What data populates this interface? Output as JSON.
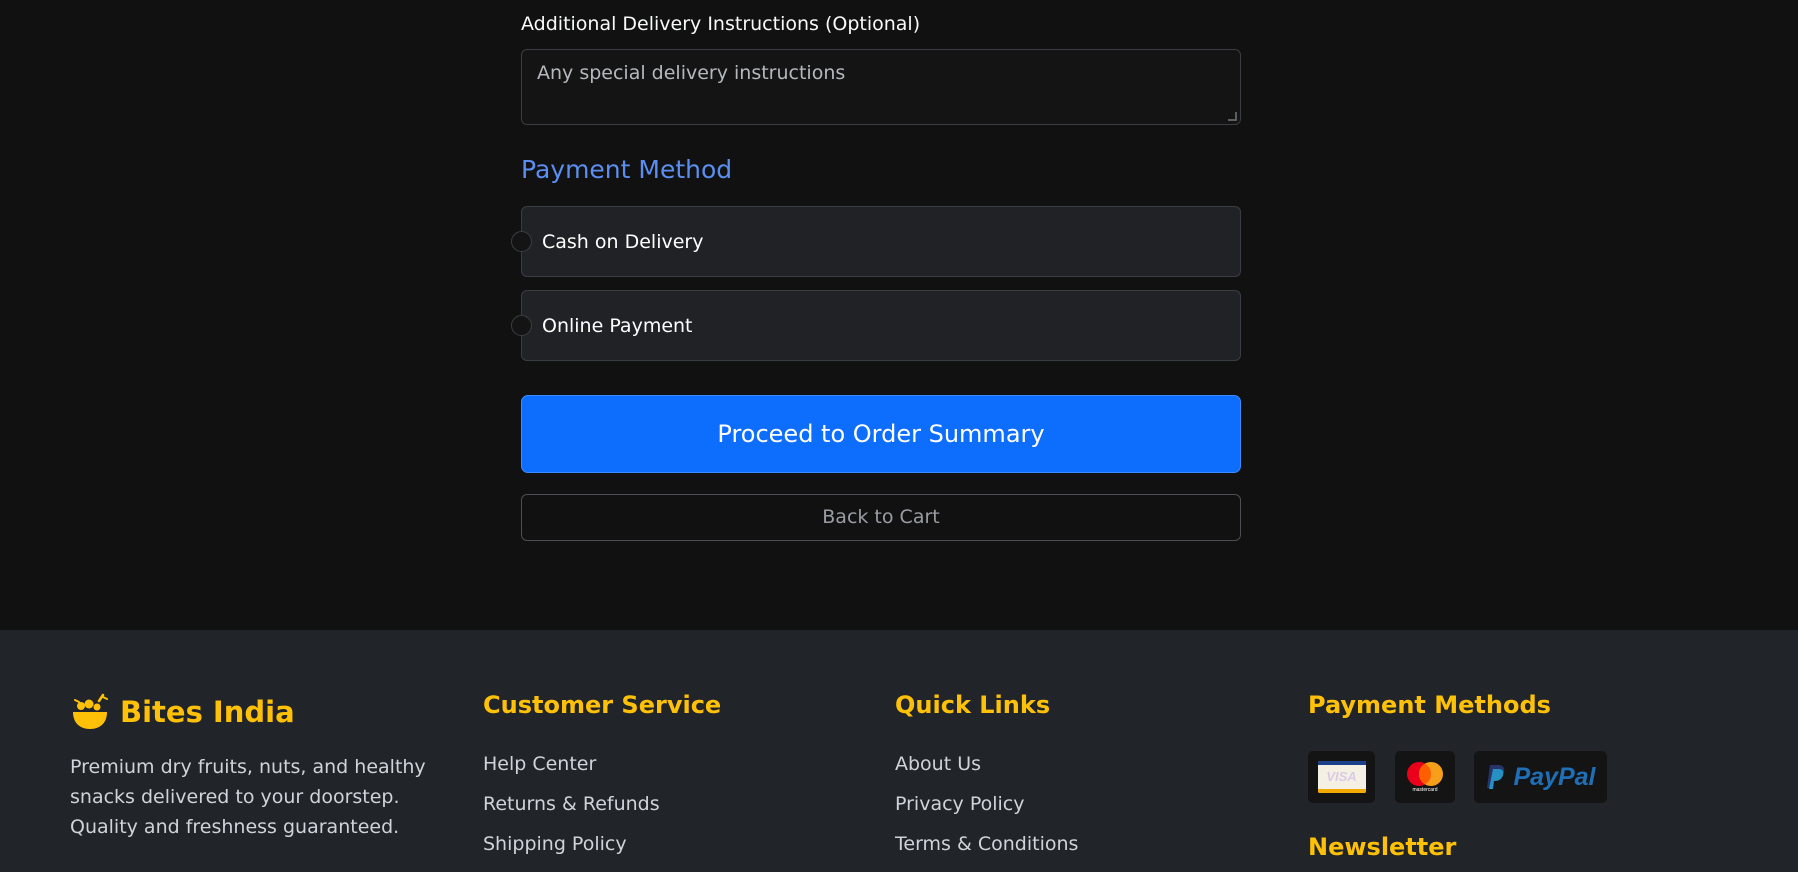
{
  "form": {
    "instructions_label": "Additional Delivery Instructions (Optional)",
    "instructions_placeholder": "Any special delivery instructions",
    "payment_title": "Payment Method",
    "payment_options": [
      {
        "label": "Cash on Delivery",
        "selected": false
      },
      {
        "label": "Online Payment",
        "selected": false
      }
    ],
    "proceed_label": "Proceed to Order Summary",
    "back_label": "Back to Cart"
  },
  "footer": {
    "brand": {
      "name": "Bites India",
      "icon": "fruit-basket-icon",
      "description": "Premium dry fruits, nuts, and healthy snacks delivered to your doorstep. Quality and freshness guaranteed."
    },
    "customer_service": {
      "title": "Customer Service",
      "links": [
        "Help Center",
        "Returns & Refunds",
        "Shipping Policy"
      ]
    },
    "quick_links": {
      "title": "Quick Links",
      "links": [
        "About Us",
        "Privacy Policy",
        "Terms & Conditions"
      ]
    },
    "payment_methods": {
      "title": "Payment Methods",
      "badges": [
        {
          "icon": "visa-icon",
          "text": "VISA"
        },
        {
          "icon": "mastercard-icon",
          "text": "mastercard"
        },
        {
          "icon": "paypal-icon",
          "text": "PayPal"
        }
      ]
    },
    "newsletter": {
      "title": "Newsletter"
    }
  },
  "colors": {
    "accent": "#ffc107",
    "primary": "#0d6efd",
    "section_title": "#5b8ef0",
    "background": "#111111",
    "footer_bg": "#212529"
  }
}
